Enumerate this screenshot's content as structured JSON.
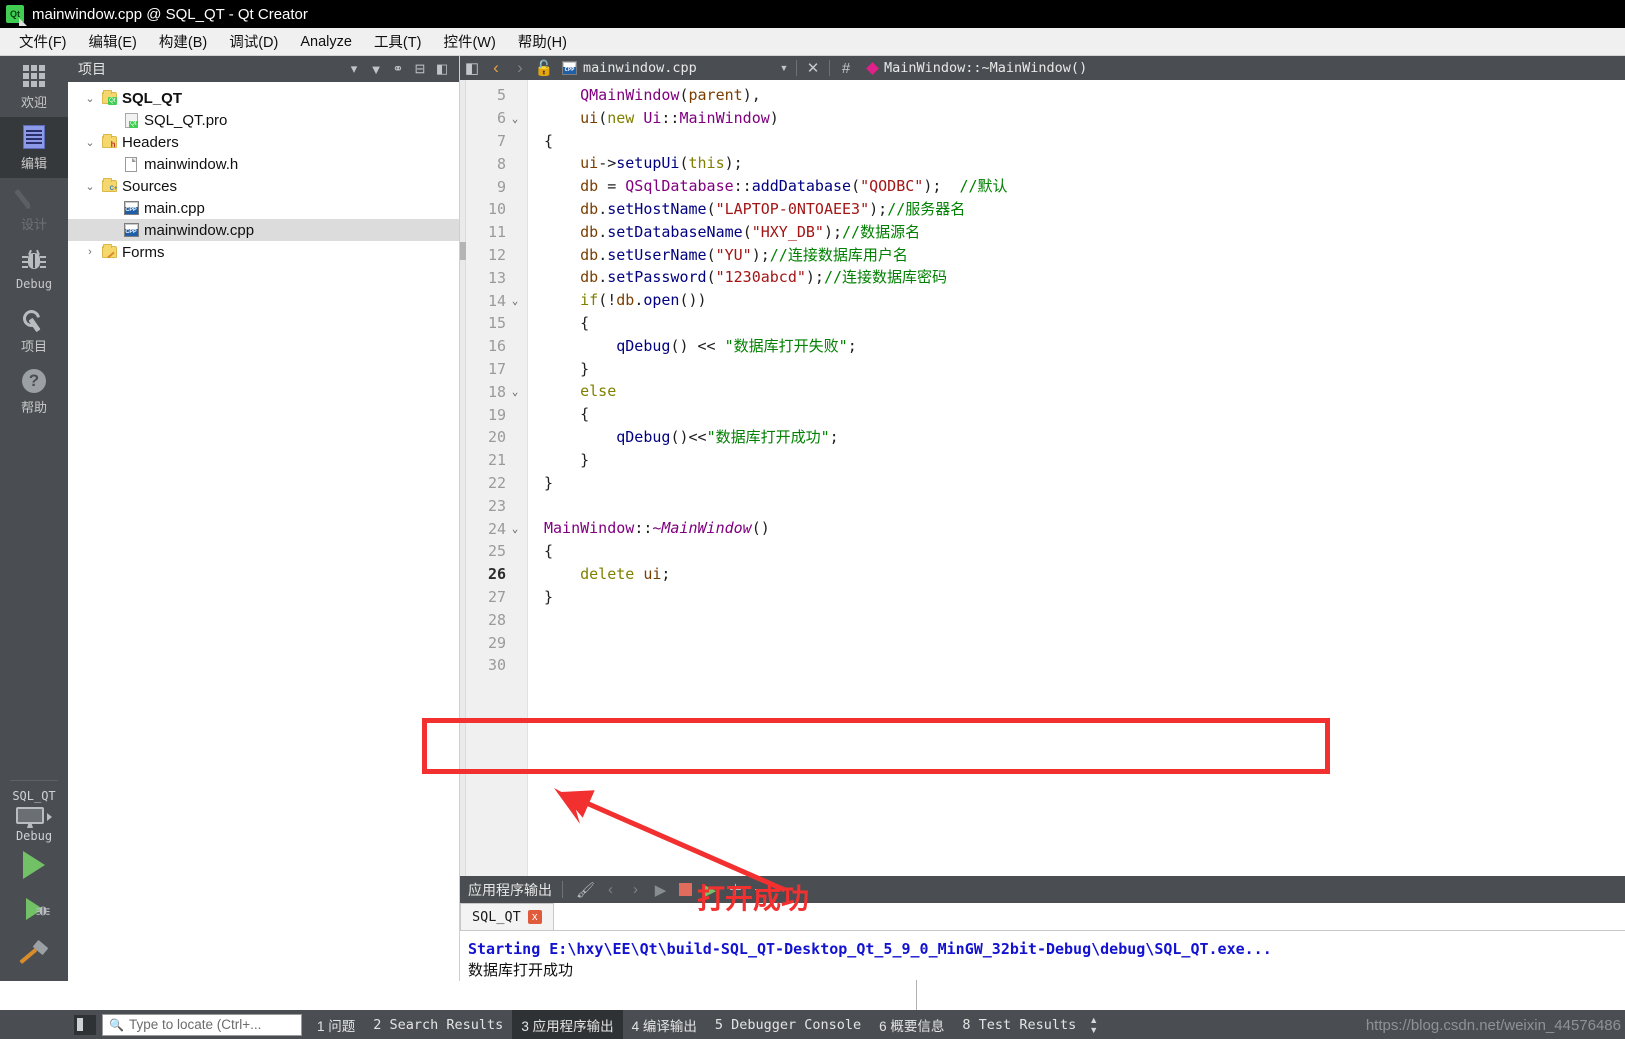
{
  "window": {
    "title": "mainwindow.cpp @ SQL_QT - Qt Creator",
    "logo_text": "Qt"
  },
  "menubar": {
    "items": [
      {
        "label": "文件(F)",
        "name": "menu-file"
      },
      {
        "label": "编辑(E)",
        "name": "menu-edit"
      },
      {
        "label": "构建(B)",
        "name": "menu-build"
      },
      {
        "label": "调试(D)",
        "name": "menu-debug"
      },
      {
        "label": "Analyze",
        "name": "menu-analyze"
      },
      {
        "label": "工具(T)",
        "name": "menu-tools"
      },
      {
        "label": "控件(W)",
        "name": "menu-window"
      },
      {
        "label": "帮助(H)",
        "name": "menu-help"
      }
    ]
  },
  "modebar": {
    "items": [
      {
        "label": "欢迎",
        "icon": "grid-icon",
        "state": "normal"
      },
      {
        "label": "编辑",
        "icon": "edit-icon",
        "state": "active"
      },
      {
        "label": "设计",
        "icon": "pencil-icon",
        "state": "disabled"
      },
      {
        "label": "Debug",
        "icon": "bug-icon",
        "state": "normal"
      },
      {
        "label": "项目",
        "icon": "wrench-icon",
        "state": "normal"
      },
      {
        "label": "帮助",
        "icon": "question-icon",
        "state": "normal"
      }
    ],
    "kit_name": "SQL_QT",
    "build_config": "Debug"
  },
  "project_panel": {
    "title": "项目",
    "toolbar_icons": [
      "chevron-down-icon",
      "filter-icon",
      "link-icon",
      "split-icon",
      "hide-sidebar-icon"
    ],
    "tree": [
      {
        "label": "SQL_QT",
        "icon": "qt-project-folder-icon",
        "indent": 0,
        "expander": "expanded",
        "bold": true,
        "selected": false
      },
      {
        "label": "SQL_QT.pro",
        "icon": "pro-file-icon",
        "indent": 1,
        "expander": "none",
        "bold": false,
        "selected": false
      },
      {
        "label": "Headers",
        "icon": "headers-folder-icon",
        "indent": 0,
        "expander": "expanded",
        "bold": false,
        "selected": false
      },
      {
        "label": "mainwindow.h",
        "icon": "header-file-icon",
        "indent": 1,
        "expander": "none",
        "bold": false,
        "selected": false
      },
      {
        "label": "Sources",
        "icon": "sources-folder-icon",
        "indent": 0,
        "expander": "expanded",
        "bold": false,
        "selected": false
      },
      {
        "label": "main.cpp",
        "icon": "cpp-file-icon",
        "indent": 1,
        "expander": "none",
        "bold": false,
        "selected": false
      },
      {
        "label": "mainwindow.cpp",
        "icon": "cpp-file-icon",
        "indent": 1,
        "expander": "none",
        "bold": false,
        "selected": true
      },
      {
        "label": "Forms",
        "icon": "forms-folder-icon",
        "indent": 0,
        "expander": "collapsed",
        "bold": false,
        "selected": false
      }
    ]
  },
  "editor_toolbar": {
    "current_file": "mainwindow.cpp",
    "current_symbol": "MainWindow::~MainWindow()",
    "hash_label": "#",
    "icons": [
      "show-sidebar-icon",
      "go-back-icon",
      "go-forward-icon",
      "unlocked-icon",
      "cpp-file-icon",
      "chevron-down-icon",
      "close-icon"
    ]
  },
  "code": {
    "first_line_number": 5,
    "current_line": 26,
    "lines": [
      {
        "n": 5,
        "fold": "",
        "html": "    <span class='t'>QMainWindow</span>(<span class='v'>parent</span>),"
      },
      {
        "n": 6,
        "fold": "v",
        "html": "    <span class='v'>ui</span>(<span class='k'>new</span> <span class='t'>Ui</span>::<span class='t'>MainWindow</span>)"
      },
      {
        "n": 7,
        "fold": "",
        "html": "{"
      },
      {
        "n": 8,
        "fold": "",
        "html": "    <span class='v'>ui</span>-&gt;<span class='f'>setupUi</span>(<span class='k'>this</span>);"
      },
      {
        "n": 9,
        "fold": "",
        "html": "    <span class='v'>db</span> = <span class='t'>QSqlDatabase</span>::<span class='f'>addDatabase</span>(<span class='m'>\"QODBC\"</span>);  <span class='c'>//默认</span>"
      },
      {
        "n": 10,
        "fold": "",
        "html": "    <span class='v'>db</span>.<span class='f'>setHostName</span>(<span class='m'>\"LAPTOP-0NTOAEE3\"</span>);<span class='c'>//服务器名</span>"
      },
      {
        "n": 11,
        "fold": "",
        "html": "    <span class='v'>db</span>.<span class='f'>setDatabaseName</span>(<span class='m'>\"HXY_DB\"</span>);<span class='c'>//数据源名</span>"
      },
      {
        "n": 12,
        "fold": "",
        "html": "    <span class='v'>db</span>.<span class='f'>setUserName</span>(<span class='m'>\"YU\"</span>);<span class='c'>//连接数据库用户名</span>"
      },
      {
        "n": 13,
        "fold": "",
        "html": "    <span class='v'>db</span>.<span class='f'>setPassword</span>(<span class='m'>\"1230abcd\"</span>);<span class='c'>//连接数据库密码</span>"
      },
      {
        "n": 14,
        "fold": "v",
        "html": "    <span class='k'>if</span>(!<span class='v'>db</span>.<span class='f'>open</span>())"
      },
      {
        "n": 15,
        "fold": "",
        "html": "    {"
      },
      {
        "n": 16,
        "fold": "",
        "html": "        <span class='f'>qDebug</span>() &lt;&lt; <span class='s'>\"数据库打开失败\"</span>;"
      },
      {
        "n": 17,
        "fold": "",
        "html": "    }"
      },
      {
        "n": 18,
        "fold": "v",
        "html": "    <span class='k'>else</span>"
      },
      {
        "n": 19,
        "fold": "",
        "html": "    {"
      },
      {
        "n": 20,
        "fold": "",
        "html": "        <span class='f'>qDebug</span>()&lt;&lt;<span class='s'>\"数据库打开成功\"</span>;"
      },
      {
        "n": 21,
        "fold": "",
        "html": "    }"
      },
      {
        "n": 22,
        "fold": "",
        "html": "}"
      },
      {
        "n": 23,
        "fold": "",
        "html": ""
      },
      {
        "n": 24,
        "fold": "v",
        "html": "<span class='t'>MainWindow</span>::<span class='t it'>~MainWindow</span>()"
      },
      {
        "n": 25,
        "fold": "",
        "html": "{"
      },
      {
        "n": 26,
        "fold": "",
        "html": "    <span class='k'>delete</span> <span class='v'>ui</span>;"
      },
      {
        "n": 27,
        "fold": "",
        "html": "}"
      },
      {
        "n": 28,
        "fold": "",
        "html": ""
      },
      {
        "n": 29,
        "fold": "",
        "html": ""
      },
      {
        "n": 30,
        "fold": "",
        "html": ""
      }
    ]
  },
  "output_pane": {
    "title": "应用程序输出",
    "toolbar_icons": [
      "clear-icon",
      "prev-item-icon",
      "next-item-icon",
      "run-icon",
      "stop-icon",
      "attach-debugger-icon",
      "zoom-in-icon",
      "zoom-out-icon"
    ],
    "tab_label": "SQL_QT",
    "tab_close_label": "x",
    "lines": [
      "Starting E:\\hxy\\EE\\Qt\\build-SQL_QT-Desktop_Qt_5_9_0_MinGW_32bit-Debug\\debug\\SQL_QT.exe...",
      "数据库打开成功"
    ]
  },
  "annotation": {
    "label": "打开成功",
    "color": "#f23030"
  },
  "statusbar": {
    "locator_placeholder": "Type to locate (Ctrl+...",
    "items": [
      {
        "label": "1 问题",
        "active": false,
        "cn": true
      },
      {
        "label": "2 Search Results",
        "active": false,
        "cn": false
      },
      {
        "label": "3 应用程序输出",
        "active": true,
        "cn": true
      },
      {
        "label": "4 编译输出",
        "active": false,
        "cn": true
      },
      {
        "label": "5 Debugger Console",
        "active": false,
        "cn": false
      },
      {
        "label": "6 概要信息",
        "active": false,
        "cn": true
      },
      {
        "label": "8 Test Results",
        "active": false,
        "cn": false
      }
    ],
    "watermark": "https://blog.csdn.net/weixin_44576486"
  },
  "colors": {
    "chrome": "#4a4e52",
    "chrome_active": "#35393c",
    "accent_green": "#41cd52",
    "annotation_red": "#f23030",
    "output_blue": "#1212d0"
  }
}
